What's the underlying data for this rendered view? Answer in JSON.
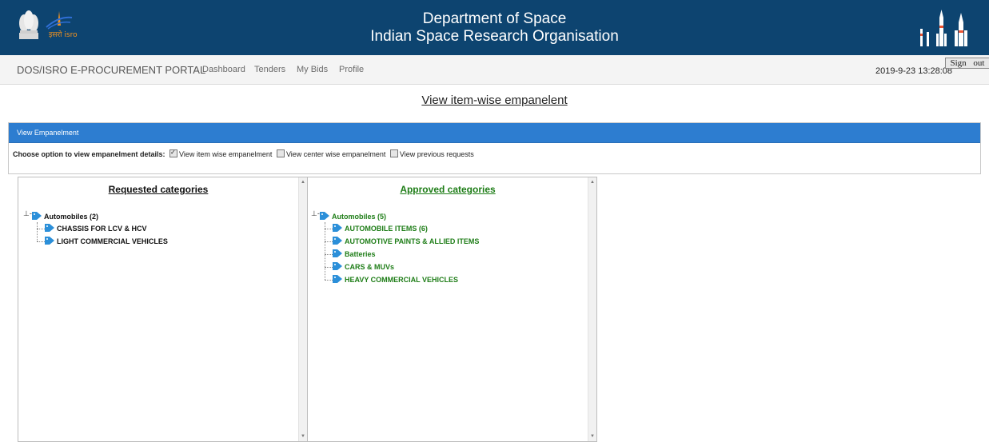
{
  "header": {
    "title_line1": "Department of Space",
    "title_line2": "Indian Space Research Organisation",
    "logo_text": "इसरो isro",
    "bg_color": "#0d4470"
  },
  "navbar": {
    "brand": "DOS/ISRO E-PROCUREMENT PORTAL",
    "links": [
      "Dashboard",
      "Tenders",
      "My Bids",
      "Profile"
    ],
    "timestamp": "2019-9-23 13:28:08",
    "signout_label": "Sign out"
  },
  "page_title": "View item-wise empanelent",
  "panel": {
    "heading": "View Empanelment",
    "prompt": "Choose option to view empanelment details:",
    "options": [
      {
        "label": "View item wise empanelment",
        "checked": true
      },
      {
        "label": "View center wise empanelment",
        "checked": false
      },
      {
        "label": "View previous requests",
        "checked": false
      }
    ],
    "accent_color": "#2d7dd0"
  },
  "requested": {
    "title": "Requested categories",
    "root": "Automobiles (2)",
    "children": [
      "CHASSIS FOR LCV & HCV",
      "LIGHT COMMERCIAL VEHICLES"
    ]
  },
  "approved": {
    "title": "Approved categories",
    "root": "Automobiles (5)",
    "children": [
      "AUTOMOBILE ITEMS (6)",
      "AUTOMOTIVE PAINTS & ALLIED ITEMS",
      "Batteries",
      "CARS & MUVs",
      "HEAVY COMMERCIAL VEHICLES"
    ],
    "color": "#1e7d17"
  },
  "icons": {
    "tag": "tag-icon",
    "expander": "expand-minus-icon",
    "scroll_up": "▲",
    "scroll_down": "▼"
  }
}
